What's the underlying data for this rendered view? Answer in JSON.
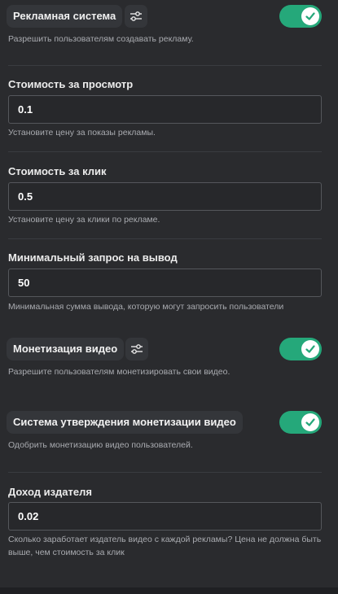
{
  "ad_system": {
    "title": "Рекламная система",
    "description": "Разрешить пользователям создавать рекламу.",
    "enabled": true
  },
  "cost_per_view": {
    "label": "Стоимость за просмотр",
    "value": "0.1",
    "hint": "Установите цену за показы рекламы."
  },
  "cost_per_click": {
    "label": "Стоимость за клик",
    "value": "0.5",
    "hint": "Установите цену за клики по рекламе."
  },
  "min_withdrawal": {
    "label": "Минимальный запрос на вывод",
    "value": "50",
    "hint": "Минимальная сумма вывода, которую могут запросить пользователи"
  },
  "video_monetization": {
    "title": "Монетизация видео",
    "description": "Разрешите пользователям монетизировать свои видео.",
    "enabled": true
  },
  "monetization_approval": {
    "title": "Система утверждения монетизации видео",
    "description": "Одобрить монетизацию видео пользователей.",
    "enabled": true
  },
  "publisher_income": {
    "label": "Доход издателя",
    "value": "0.02",
    "hint": "Сколько заработает издатель видео с каждой рекламы? Цена не должна быть выше, чем стоимость за клик"
  },
  "colors": {
    "background": "#2a2b2e",
    "toggle_on": "#25a87a",
    "pill": "#34363a",
    "hint_text": "#a9abb0",
    "field_border": "#55575c"
  },
  "icons": {
    "settings": "sliders-icon",
    "toggle_check": "check-icon"
  }
}
